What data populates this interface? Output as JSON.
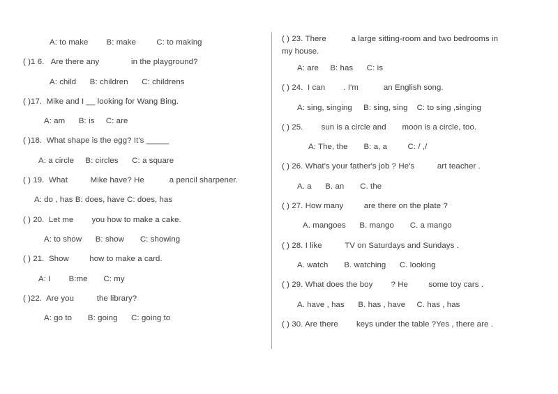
{
  "document": {
    "type": "english-grammar-worksheet",
    "page_background": "#ffffff",
    "text_color": "#4f4f4f",
    "divider_color": "#a9a9a9"
  },
  "left_column": {
    "lead_options": "A: to make        B: make         C: to making",
    "questions": [
      {
        "number": "16",
        "stem": "( )1 6.   Are there any              in the playground?",
        "options": "A: child      B: children      C: childrens",
        "stem_indent": "i0",
        "options_indent": "i5"
      },
      {
        "number": "17",
        "stem": "( )17.  Mike and I __ looking for Wang Bing.",
        "options": "A: am      B: is     C: are",
        "stem_indent": "i0",
        "options_indent": "i4"
      },
      {
        "number": "18",
        "stem": "( )18.  What shape is the egg? It's _____",
        "options": "A: a circle     B: circles      C: a square",
        "stem_indent": "i0",
        "options_indent": "i3"
      },
      {
        "number": "19",
        "stem": "( ) 19.  What          Mike have? He           a pencil sharpener.",
        "options": "A: do , has B: does, have C: does, has",
        "stem_indent": "i0",
        "options_indent": "i2"
      },
      {
        "number": "20",
        "stem": "( ) 20.  Let me        you how to make a cake.",
        "options": "A: to show      B: show       C: showing",
        "stem_indent": "i0",
        "options_indent": "i4"
      },
      {
        "number": "21",
        "stem": "( ) 21.  Show         how to make a card.",
        "options": "A: I        B:me       C: my",
        "stem_indent": "i0",
        "options_indent": "i3"
      },
      {
        "number": "22",
        "stem": "( )22.  Are you          the library?",
        "options": "A: go to       B: going      C: going to",
        "stem_indent": "i0",
        "options_indent": "i4"
      }
    ]
  },
  "right_column": {
    "questions": [
      {
        "number": "23",
        "stem": "( ) 23. There           a large sitting-room and two bedrooms in",
        "stem_cont": "my house.",
        "options": "A: are     B: has      C: is",
        "stem_indent": "i0",
        "options_indent": "i3"
      },
      {
        "number": "24",
        "stem": "( ) 24.  I can        . I'm           an English song.",
        "options": "A: sing, singing     B: sing, sing    C: to sing ,singing",
        "stem_indent": "i0",
        "options_indent": "i3"
      },
      {
        "number": "25",
        "stem": "( ) 25.        sun is a circle and       moon is a circle, too.",
        "options": "A: The, the       B: a, a         C: / ,/",
        "stem_indent": "i0",
        "options_indent": "i5"
      },
      {
        "number": "26",
        "stem": "( ) 26. What's your father's job ? He's          art teacher .",
        "options": "A. a      B. an       C. the",
        "stem_indent": "i0",
        "options_indent": "i3"
      },
      {
        "number": "27",
        "stem": "( ) 27. How many         are there on the plate ?",
        "options": "A. mangoes      B. mango       C. a mango",
        "stem_indent": "i0",
        "options_indent": "i4"
      },
      {
        "number": "28",
        "stem": "( ) 28. I like          TV on Saturdays and Sundays .",
        "options": "A. watch       B. watching      C. looking",
        "stem_indent": "i0",
        "options_indent": "i3"
      },
      {
        "number": "29",
        "stem": "( ) 29. What does the boy        ? He         some toy cars .",
        "options": "A. have , has      B. has , have     C. has , has",
        "stem_indent": "i0",
        "options_indent": "i3"
      },
      {
        "number": "30",
        "stem": "( ) 30. Are there        keys under the table ?Yes , there are .",
        "options": "",
        "stem_indent": "i0",
        "options_indent": "i3"
      }
    ]
  }
}
